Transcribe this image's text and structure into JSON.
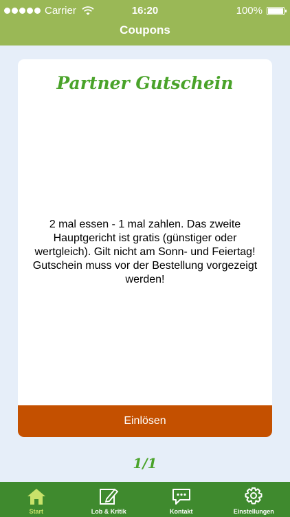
{
  "status_bar": {
    "carrier": "Carrier",
    "time": "16:20",
    "battery": "100%"
  },
  "header": {
    "title": "Coupons"
  },
  "coupon": {
    "title": "Partner Gutschein",
    "description": "2 mal essen - 1 mal zahlen. Das zweite Hauptgericht ist gratis (günstiger oder wertgleich). Gilt nicht am Sonn- und Feiertag! Gutschein muss vor der Bestellung vorgezeigt werden!",
    "redeem_label": "Einlösen"
  },
  "pager": {
    "text": "1/1"
  },
  "tabs": [
    {
      "label": "Start",
      "icon": "home-icon",
      "active": true
    },
    {
      "label": "Lob & Kritik",
      "icon": "edit-note-icon",
      "active": false
    },
    {
      "label": "Kontakt",
      "icon": "chat-bubble-icon",
      "active": false
    },
    {
      "label": "Einstellungen",
      "icon": "gear-icon",
      "active": false
    }
  ],
  "colors": {
    "header": "#9ab856",
    "accent_green": "#4aa32a",
    "button": "#c45000",
    "tabbar": "#3f8a2e",
    "tab_active": "#c9e26a",
    "background": "#e6eef9"
  }
}
